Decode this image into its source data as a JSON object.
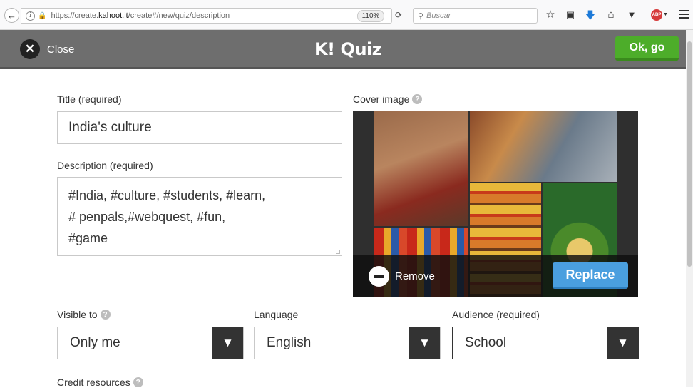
{
  "browser": {
    "url_prefix": "https://create.",
    "url_host": "kahoot.it",
    "url_path": "/create#/new/quiz/description",
    "zoom": "110%",
    "search_placeholder": "Buscar"
  },
  "header": {
    "close_label": "Close",
    "brand_logo": "K!",
    "brand_title": "Quiz",
    "ok_label": "Ok, go"
  },
  "form": {
    "title_label": "Title (required)",
    "title_value": "India's culture",
    "description_label": "Description (required)",
    "description_lines": [
      "#India, #culture, #students, #learn,",
      "# penpals,#webquest, #fun,",
      "#game"
    ],
    "cover_label": "Cover image",
    "remove_label": "Remove",
    "replace_label": "Replace",
    "visible_label": "Visible to",
    "visible_value": "Only me",
    "language_label": "Language",
    "language_value": "English",
    "audience_label": "Audience (required)",
    "audience_value": "School",
    "credit_label": "Credit resources"
  },
  "colors": {
    "header_bg": "#6e6e6e",
    "ok_green": "#4dad2a",
    "replace_blue": "#4a9fdf"
  }
}
